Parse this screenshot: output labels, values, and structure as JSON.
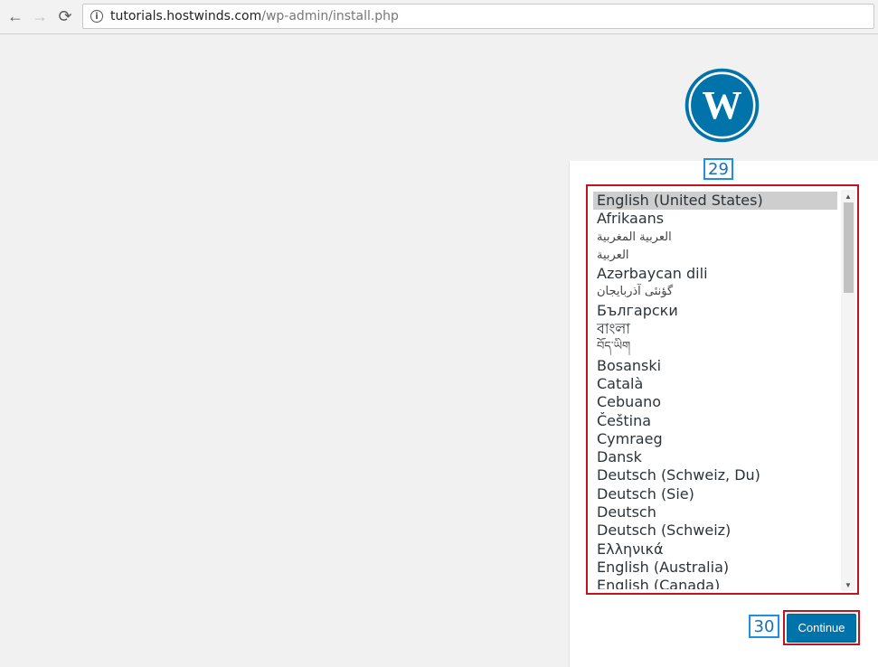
{
  "browser": {
    "back_icon": "←",
    "forward_icon": "→",
    "reload_icon": "⟳",
    "url_host": "tutorials.hostwinds.com",
    "url_path": "/wp-admin/install.php"
  },
  "callouts": {
    "languages": "29",
    "continue": "30"
  },
  "languages": [
    "English (United States)",
    "Afrikaans",
    "العربية المغربية",
    "العربية",
    "Azərbaycan dili",
    "گؤنئی آذربایجان",
    "Български",
    "বাংলা",
    "བོད་ཡིག",
    "Bosanski",
    "Català",
    "Cebuano",
    "Čeština",
    "Cymraeg",
    "Dansk",
    "Deutsch (Schweiz, Du)",
    "Deutsch (Sie)",
    "Deutsch",
    "Deutsch (Schweiz)",
    "Ελληνικά",
    "English (Australia)",
    "English (Canada)"
  ],
  "selected_language": "English (United States)",
  "continue_label": "Continue",
  "colors": {
    "wp_blue": "#0073aa",
    "highlight_red": "#c0151e",
    "callout_blue": "#1e8fe1"
  }
}
